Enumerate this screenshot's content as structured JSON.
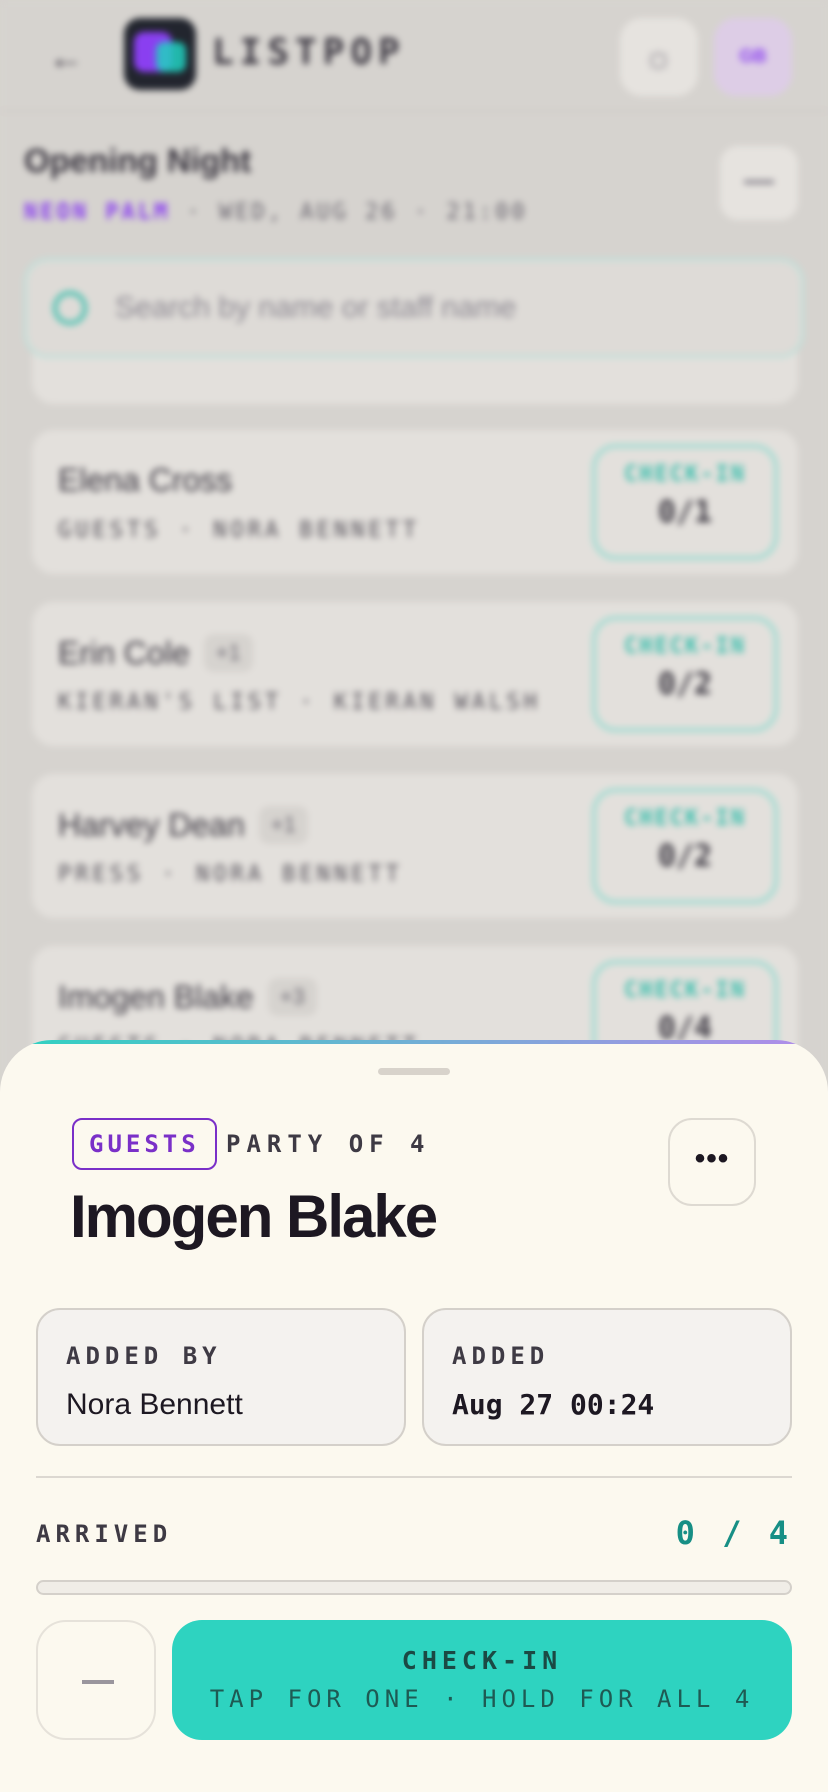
{
  "app": {
    "brand": "LISTPOP",
    "avatar_initials": "GB"
  },
  "event": {
    "title": "Opening Night",
    "venue": "NEON PALM",
    "details": "· WED, AUG 26 · 21:00"
  },
  "search": {
    "placeholder": "Search by name or staff name"
  },
  "guest_list": {
    "checkin_label": "CHECK-IN",
    "rows": [
      {
        "name": "Elena Cross",
        "plus": "",
        "list": "GUESTS · NORA BENNETT",
        "count": "0/1"
      },
      {
        "name": "Erin Cole",
        "plus": "+1",
        "list": "KIERAN'S LIST · KIERAN WALSH",
        "count": "0/2"
      },
      {
        "name": "Harvey Dean",
        "plus": "+1",
        "list": "PRESS · NORA BENNETT",
        "count": "0/2"
      },
      {
        "name": "Imogen Blake",
        "plus": "+3",
        "list": "GUESTS · NORA BENNETT",
        "count": "0/4"
      }
    ]
  },
  "sheet": {
    "tag": "GUESTS",
    "party": "PARTY OF 4",
    "name": "Imogen Blake",
    "more_label": "•••",
    "added_by_label": "ADDED BY",
    "added_by": "Nora Bennett",
    "added_label": "ADDED",
    "added_at": "Aug 27 00:24",
    "arrived_label": "ARRIVED",
    "arrived_value": "0 / 4",
    "arrived_fraction": 0,
    "checkin_title": "CHECK-IN",
    "checkin_hint": "TAP FOR ONE · HOLD FOR ALL 4"
  },
  "colors": {
    "accent_teal": "#2ed3c0",
    "accent_purple": "#7a30c8",
    "sheet_bg": "#fcf9ef"
  }
}
